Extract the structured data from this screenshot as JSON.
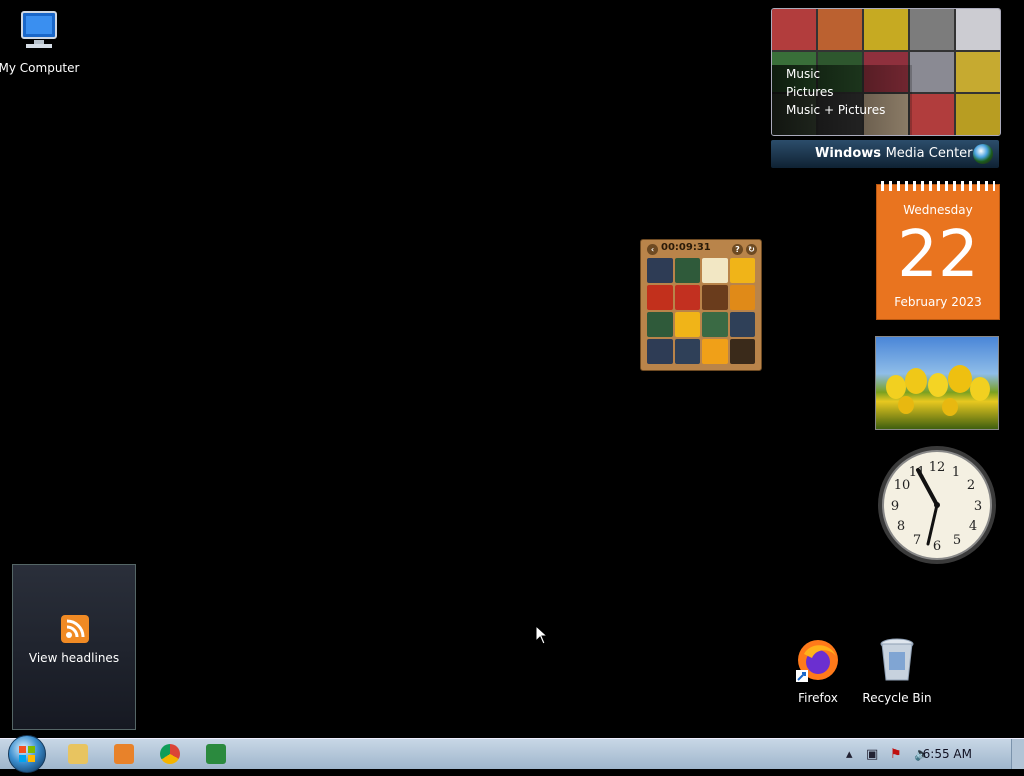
{
  "desktop": {
    "icons": {
      "my_computer": "My Computer",
      "firefox": "Firefox",
      "recycle_bin": "Recycle Bin"
    }
  },
  "gadgets": {
    "media_center": {
      "menu": [
        "Music",
        "Pictures",
        "Music + Pictures"
      ],
      "brand_bold": "Windows",
      "brand_rest": "Media Center"
    },
    "calendar": {
      "weekday": "Wednesday",
      "day": "22",
      "month_year": "February 2023"
    },
    "puzzle": {
      "timer": "00:09:31"
    },
    "clock": {
      "numerals": [
        "12",
        "1",
        "2",
        "3",
        "4",
        "5",
        "6",
        "7",
        "8",
        "9",
        "10",
        "11"
      ]
    },
    "feed": {
      "label": "View headlines"
    }
  },
  "taskbar": {
    "time": "6:55 AM",
    "pinned": [
      "explorer-icon",
      "media-player-icon",
      "chrome-icon",
      "csharp-app-icon"
    ],
    "tray": [
      "show-hidden-icon",
      "network-icon",
      "action-center-icon",
      "volume-icon"
    ]
  }
}
